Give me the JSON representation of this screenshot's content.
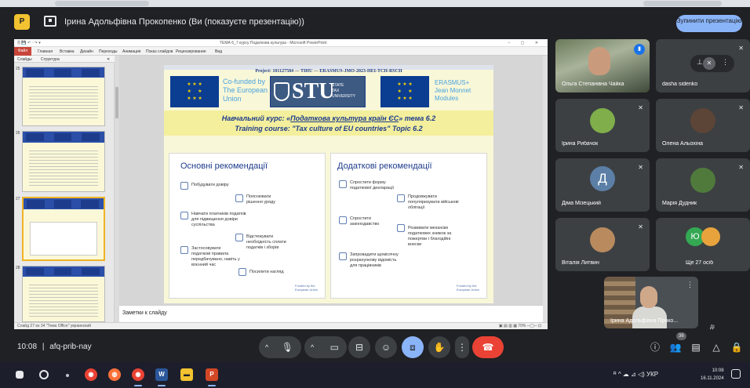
{
  "banner": {
    "title": "Ірина Адольфівна Прокопенко (Ви (показуєте презентацію))",
    "stop_label": "Зупинити презентацію",
    "app_icon": "powerpoint-icon",
    "present_icon": "present-screen-icon"
  },
  "powerpoint": {
    "title": "ТЕМА 6_7 курсу Податкова культура - Microsoft PowerPoint",
    "quick_access": "🗎 💾 ↶ · ↷ ▾",
    "window_controls": "–  ▢  ✕",
    "file_tab": "Файл",
    "tabs": [
      "Главная",
      "Вставка",
      "Дизайн",
      "Переходы",
      "Анимация",
      "Показ слайдов",
      "Рецензирование",
      "Вид"
    ],
    "pane_tabs": [
      "Слайды",
      "Структура",
      "✕"
    ],
    "thumbnail_numbers": [
      "25",
      "26",
      "27",
      "28"
    ],
    "notes_placeholder": "Заметки к слайду",
    "status_left": "Слайд 27 из 34   \"Тема Office\"   украинский",
    "status_right": "▣ ▤ ▥ ▦  70%  ─◯─  ⊡",
    "slide": {
      "project_line": "Project: 101127584 — TIHU — ERASMUS-JMO-2023-HEI-TCH-RSCH",
      "cofunded": [
        "Co-funded by",
        "The European",
        "Union"
      ],
      "stu_big": "STU",
      "stu_small": [
        "STATE",
        "TAX",
        "UNIVERSITY"
      ],
      "erasmus": [
        "ERASMUS+",
        "Jean Monnet",
        "Modules"
      ],
      "course_ua_prefix": "Навчальний курс: «",
      "course_ua_name": "Податкова культура країн ЄС",
      "course_ua_suffix": "» тема 6.2",
      "course_en": "Training course: \"Tax culture of EU countries\" Topic 6.2",
      "left_heading": "Основні рекомендації",
      "left_items": [
        "Побудувати довіру",
        "Пояснювати рішення уряду",
        "Навчати платників податків для підвищення довіри суспільства",
        "Відстежувати необхідність сплати податків і зборів",
        "Застосовувати податкові правила передбачувано, навіть у воєнний час",
        "Посилити нагляд"
      ],
      "right_heading": "Додаткові рекомендації",
      "right_items": [
        "Спростити форму податкової декларації",
        "Продовжувати популяризувати військові облігації",
        "Спростити законодавство",
        "Розвивати механізм податкових знижок за пожертви і благодійні внески",
        "Запровадити щомісячну розрахункову відомість для працівників"
      ],
      "panel_logo": "Funded by the European Union"
    }
  },
  "participants": [
    {
      "name": "Ольга Степанівна Чайка",
      "kind": "video",
      "speaking": true
    },
    {
      "name": "dasha sidenko",
      "kind": "hover",
      "muted": true
    },
    {
      "name": "Ірина Рибачок",
      "kind": "photo",
      "muted": true,
      "color": "#7fae4a"
    },
    {
      "name": "Олена Альохіна",
      "kind": "photo",
      "muted": true,
      "color": "#5c4436"
    },
    {
      "name": "Діма Мізецький",
      "kind": "letter",
      "letter": "Д",
      "muted": true
    },
    {
      "name": "Марія Дудник",
      "kind": "photo",
      "muted": true,
      "color": "#4f7a3c"
    },
    {
      "name": "Віталія Литвин",
      "kind": "photo",
      "muted": true,
      "color": "#b88a5e"
    },
    {
      "name": "Ще 27 осіб",
      "kind": "more",
      "letters": [
        "Ю",
        ""
      ]
    }
  ],
  "self_view": {
    "name": "Ірина Адольфівна Проко..."
  },
  "controls": {
    "time": "10:08",
    "separator": "|",
    "meeting_code": "afq-prib-nay",
    "participant_count": "36",
    "hint": "ДІ",
    "chevron": "^",
    "mic_glyph": "🎙",
    "cam_glyph": "▭",
    "cc_glyph": "⊟",
    "emoji_glyph": "☺",
    "present_glyph": "⧈",
    "hand_glyph": "✋",
    "more_glyph": "⋮",
    "hangup_glyph": "☎"
  },
  "taskbar": {
    "tray": "ᴿ  ^  ☁  ⊿  ◁)  УКР",
    "time": "10:08",
    "date": "16.11.2024",
    "apps": [
      "windows-start-icon",
      "search-icon",
      "chrome-icon",
      "firefox-icon",
      "chrome-icon",
      "word-icon",
      "file-explorer-icon",
      "powerpoint-icon"
    ]
  }
}
